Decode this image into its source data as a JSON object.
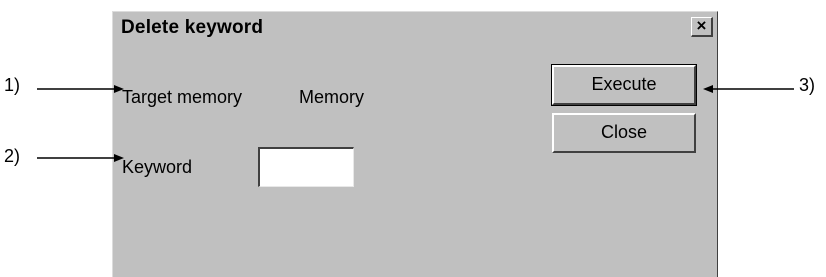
{
  "dialog": {
    "title": "Delete keyword",
    "close_glyph": "×",
    "target_memory_label": "Target memory",
    "target_memory_value": "Memory",
    "keyword_label": "Keyword",
    "keyword_value": "",
    "execute_label": "Execute",
    "close_label": "Close"
  },
  "callouts": {
    "one": "1)",
    "two": "2)",
    "three": "3)"
  },
  "icons": {
    "close": "close-icon",
    "arrow": "arrow-icon"
  }
}
